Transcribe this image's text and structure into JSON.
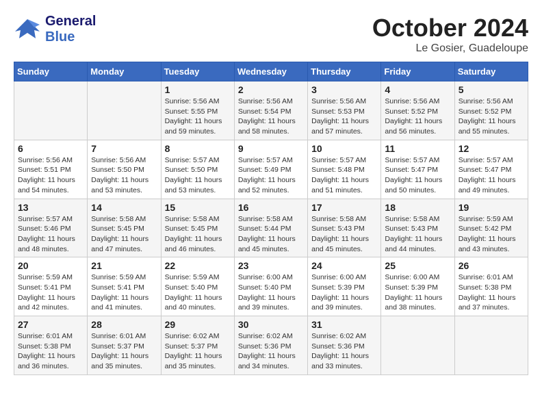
{
  "header": {
    "logo_line1": "General",
    "logo_line2": "Blue",
    "month": "October 2024",
    "location": "Le Gosier, Guadeloupe"
  },
  "columns": [
    "Sunday",
    "Monday",
    "Tuesday",
    "Wednesday",
    "Thursday",
    "Friday",
    "Saturday"
  ],
  "weeks": [
    [
      {
        "day": "",
        "info": ""
      },
      {
        "day": "",
        "info": ""
      },
      {
        "day": "1",
        "info": "Sunrise: 5:56 AM\nSunset: 5:55 PM\nDaylight: 11 hours and 59 minutes."
      },
      {
        "day": "2",
        "info": "Sunrise: 5:56 AM\nSunset: 5:54 PM\nDaylight: 11 hours and 58 minutes."
      },
      {
        "day": "3",
        "info": "Sunrise: 5:56 AM\nSunset: 5:53 PM\nDaylight: 11 hours and 57 minutes."
      },
      {
        "day": "4",
        "info": "Sunrise: 5:56 AM\nSunset: 5:52 PM\nDaylight: 11 hours and 56 minutes."
      },
      {
        "day": "5",
        "info": "Sunrise: 5:56 AM\nSunset: 5:52 PM\nDaylight: 11 hours and 55 minutes."
      }
    ],
    [
      {
        "day": "6",
        "info": "Sunrise: 5:56 AM\nSunset: 5:51 PM\nDaylight: 11 hours and 54 minutes."
      },
      {
        "day": "7",
        "info": "Sunrise: 5:56 AM\nSunset: 5:50 PM\nDaylight: 11 hours and 53 minutes."
      },
      {
        "day": "8",
        "info": "Sunrise: 5:57 AM\nSunset: 5:50 PM\nDaylight: 11 hours and 53 minutes."
      },
      {
        "day": "9",
        "info": "Sunrise: 5:57 AM\nSunset: 5:49 PM\nDaylight: 11 hours and 52 minutes."
      },
      {
        "day": "10",
        "info": "Sunrise: 5:57 AM\nSunset: 5:48 PM\nDaylight: 11 hours and 51 minutes."
      },
      {
        "day": "11",
        "info": "Sunrise: 5:57 AM\nSunset: 5:47 PM\nDaylight: 11 hours and 50 minutes."
      },
      {
        "day": "12",
        "info": "Sunrise: 5:57 AM\nSunset: 5:47 PM\nDaylight: 11 hours and 49 minutes."
      }
    ],
    [
      {
        "day": "13",
        "info": "Sunrise: 5:57 AM\nSunset: 5:46 PM\nDaylight: 11 hours and 48 minutes."
      },
      {
        "day": "14",
        "info": "Sunrise: 5:58 AM\nSunset: 5:45 PM\nDaylight: 11 hours and 47 minutes."
      },
      {
        "day": "15",
        "info": "Sunrise: 5:58 AM\nSunset: 5:45 PM\nDaylight: 11 hours and 46 minutes."
      },
      {
        "day": "16",
        "info": "Sunrise: 5:58 AM\nSunset: 5:44 PM\nDaylight: 11 hours and 45 minutes."
      },
      {
        "day": "17",
        "info": "Sunrise: 5:58 AM\nSunset: 5:43 PM\nDaylight: 11 hours and 45 minutes."
      },
      {
        "day": "18",
        "info": "Sunrise: 5:58 AM\nSunset: 5:43 PM\nDaylight: 11 hours and 44 minutes."
      },
      {
        "day": "19",
        "info": "Sunrise: 5:59 AM\nSunset: 5:42 PM\nDaylight: 11 hours and 43 minutes."
      }
    ],
    [
      {
        "day": "20",
        "info": "Sunrise: 5:59 AM\nSunset: 5:41 PM\nDaylight: 11 hours and 42 minutes."
      },
      {
        "day": "21",
        "info": "Sunrise: 5:59 AM\nSunset: 5:41 PM\nDaylight: 11 hours and 41 minutes."
      },
      {
        "day": "22",
        "info": "Sunrise: 5:59 AM\nSunset: 5:40 PM\nDaylight: 11 hours and 40 minutes."
      },
      {
        "day": "23",
        "info": "Sunrise: 6:00 AM\nSunset: 5:40 PM\nDaylight: 11 hours and 39 minutes."
      },
      {
        "day": "24",
        "info": "Sunrise: 6:00 AM\nSunset: 5:39 PM\nDaylight: 11 hours and 39 minutes."
      },
      {
        "day": "25",
        "info": "Sunrise: 6:00 AM\nSunset: 5:39 PM\nDaylight: 11 hours and 38 minutes."
      },
      {
        "day": "26",
        "info": "Sunrise: 6:01 AM\nSunset: 5:38 PM\nDaylight: 11 hours and 37 minutes."
      }
    ],
    [
      {
        "day": "27",
        "info": "Sunrise: 6:01 AM\nSunset: 5:38 PM\nDaylight: 11 hours and 36 minutes."
      },
      {
        "day": "28",
        "info": "Sunrise: 6:01 AM\nSunset: 5:37 PM\nDaylight: 11 hours and 35 minutes."
      },
      {
        "day": "29",
        "info": "Sunrise: 6:02 AM\nSunset: 5:37 PM\nDaylight: 11 hours and 35 minutes."
      },
      {
        "day": "30",
        "info": "Sunrise: 6:02 AM\nSunset: 5:36 PM\nDaylight: 11 hours and 34 minutes."
      },
      {
        "day": "31",
        "info": "Sunrise: 6:02 AM\nSunset: 5:36 PM\nDaylight: 11 hours and 33 minutes."
      },
      {
        "day": "",
        "info": ""
      },
      {
        "day": "",
        "info": ""
      }
    ]
  ]
}
